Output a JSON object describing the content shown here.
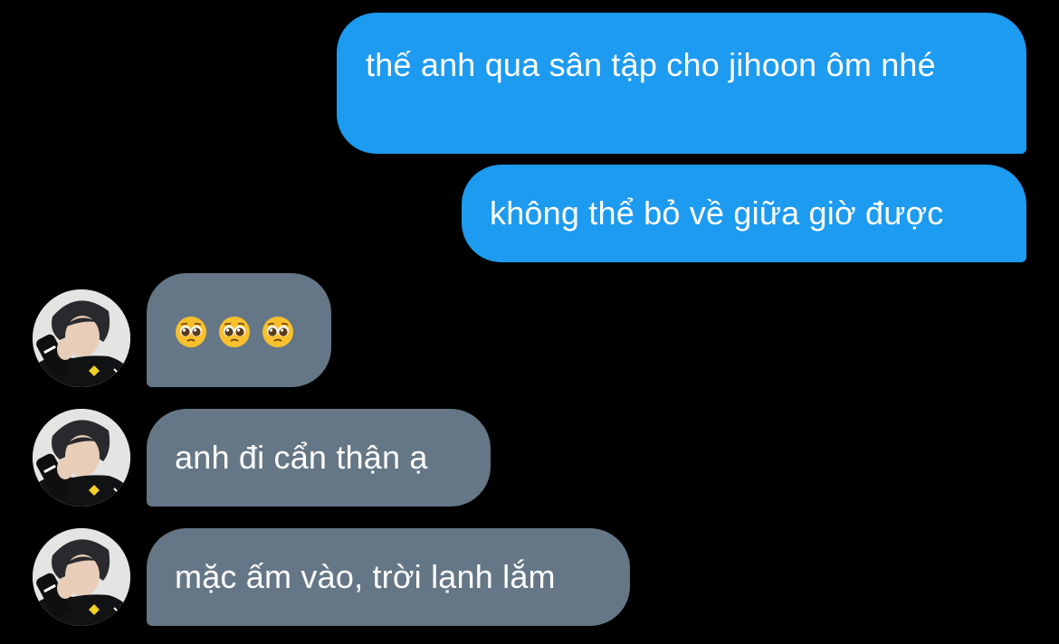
{
  "colors": {
    "background": "#000000",
    "outgoing_bubble": "#1d9bf0",
    "incoming_bubble": "#657786",
    "text": "#ffffff"
  },
  "messages": [
    {
      "direction": "outgoing",
      "text": "thế anh qua sân tập cho jihoon ôm nhé"
    },
    {
      "direction": "outgoing",
      "text": "không thể bỏ về giữa giờ được"
    },
    {
      "direction": "incoming",
      "emoji": [
        "pleading-face-emoji",
        "pleading-face-emoji",
        "pleading-face-emoji"
      ]
    },
    {
      "direction": "incoming",
      "text": "anh đi cẩn thận ạ"
    },
    {
      "direction": "incoming",
      "text": "mặc ấm vào, trời lạnh lắm"
    }
  ]
}
